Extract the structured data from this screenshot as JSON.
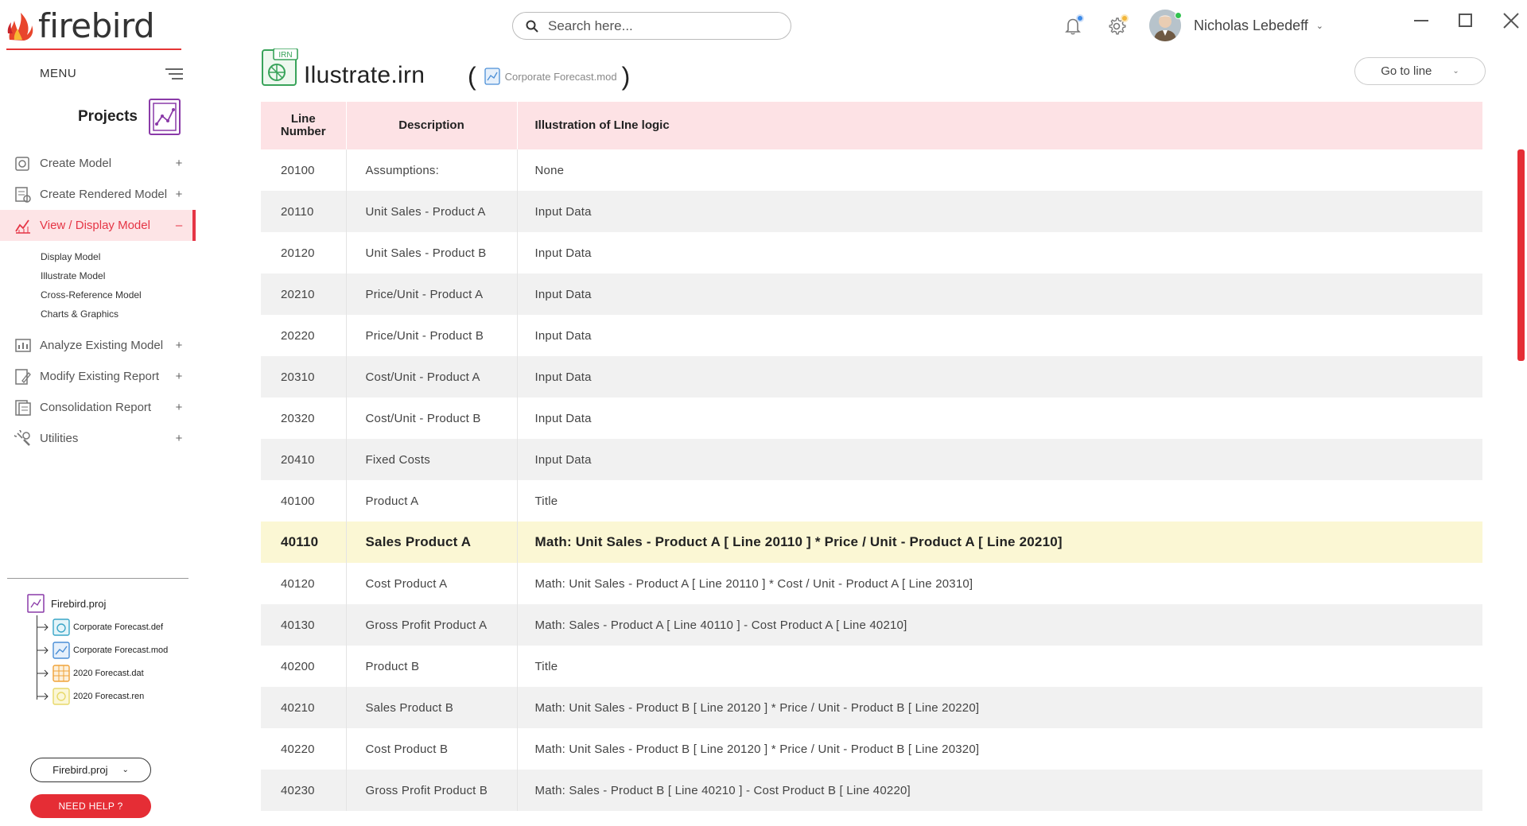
{
  "app": {
    "logo_text": "firebird"
  },
  "sidebar": {
    "menu_label": "MENU",
    "projects_label": "Projects",
    "items": [
      {
        "label": "Create Model",
        "toggle": "+",
        "icon": "create-model-icon"
      },
      {
        "label": "Create Rendered Model",
        "toggle": "+",
        "icon": "rendered-model-icon"
      },
      {
        "label": "View / Display Model",
        "toggle": "–",
        "icon": "view-model-icon",
        "active": true
      },
      {
        "label": "Analyze Existing Model",
        "toggle": "+",
        "icon": "analyze-model-icon"
      },
      {
        "label": "Modify Existing Report",
        "toggle": "+",
        "icon": "modify-report-icon"
      },
      {
        "label": "Consolidation Report",
        "toggle": "+",
        "icon": "consolidation-report-icon"
      },
      {
        "label": "Utilities",
        "toggle": "+",
        "icon": "utilities-icon"
      }
    ],
    "subitems": [
      "Display Model",
      "Illustrate Model",
      "Cross-Reference Model",
      "Charts & Graphics"
    ],
    "tree": {
      "root": "Firebird.proj",
      "children": [
        {
          "label": "Corporate Forecast.def",
          "color": "#3aa6c7"
        },
        {
          "label": "Corporate Forecast.mod",
          "color": "#4a8ed6"
        },
        {
          "label": "2020 Forecast.dat",
          "color": "#f0a33a"
        },
        {
          "label": "2020 Forecast.ren",
          "color": "#e8d96a"
        }
      ]
    },
    "project_select": "Firebird.proj",
    "help_label": "NEED HELP ?"
  },
  "topbar": {
    "search_placeholder": "Search here...",
    "user_name": "Nicholas Lebedeff",
    "bell_badge_color": "#3d8be8",
    "gear_badge_color": "#f2b63a"
  },
  "document": {
    "title": "Ilustrate.irn",
    "icon_label": "IRN",
    "source_file": "Corporate Forecast.mod",
    "goto_label": "Go to line",
    "columns": [
      "Line Number",
      "Description",
      "Illustration of LIne logic"
    ],
    "rows": [
      {
        "line": "20100",
        "desc": "Assumptions:",
        "logic": "None"
      },
      {
        "line": "20110",
        "desc": "Unit Sales - Product A",
        "logic": "Input Data"
      },
      {
        "line": "20120",
        "desc": "Unit Sales - Product B",
        "logic": "Input Data"
      },
      {
        "line": "20210",
        "desc": "Price/Unit - Product A",
        "logic": "Input Data"
      },
      {
        "line": "20220",
        "desc": "Price/Unit - Product B",
        "logic": "Input Data"
      },
      {
        "line": "20310",
        "desc": "Cost/Unit - Product A",
        "logic": "Input Data"
      },
      {
        "line": "20320",
        "desc": "Cost/Unit - Product B",
        "logic": "Input Data"
      },
      {
        "line": "20410",
        "desc": "Fixed Costs",
        "logic": "Input Data"
      },
      {
        "line": "40100",
        "desc": "Product A",
        "logic": "Title"
      },
      {
        "line": "40110",
        "desc": "Sales Product A",
        "logic": "Math: Unit Sales - Product A [ Line 20110 ] * Price / Unit - Product A [ Line 20210]",
        "highlight": true
      },
      {
        "line": "40120",
        "desc": "Cost Product A",
        "logic": "Math: Unit Sales - Product A [ Line 20110 ] * Cost / Unit - Product A [ Line 20310]"
      },
      {
        "line": "40130",
        "desc": "Gross Profit Product A",
        "logic": "Math: Sales - Product A [ Line 40110 ] - Cost Product A [ Line 40210]"
      },
      {
        "line": "40200",
        "desc": "Product B",
        "logic": "Title"
      },
      {
        "line": "40210",
        "desc": "Sales Product B",
        "logic": "Math: Unit Sales - Product B [ Line 20120 ] * Price / Unit - Product B [ Line 20220]"
      },
      {
        "line": "40220",
        "desc": "Cost Product B",
        "logic": "Math: Unit Sales - Product B [ Line 20120 ] * Price / Unit - Product B [ Line 20320]"
      },
      {
        "line": "40230",
        "desc": "Gross Profit Product B",
        "logic": "Math: Sales - Product B [ Line 40210 ] - Cost Product B [ Line 40220]"
      }
    ]
  },
  "colors": {
    "accent": "#e52d35",
    "header_bg": "#fde2e5",
    "highlight_bg": "#fbf7d4"
  }
}
